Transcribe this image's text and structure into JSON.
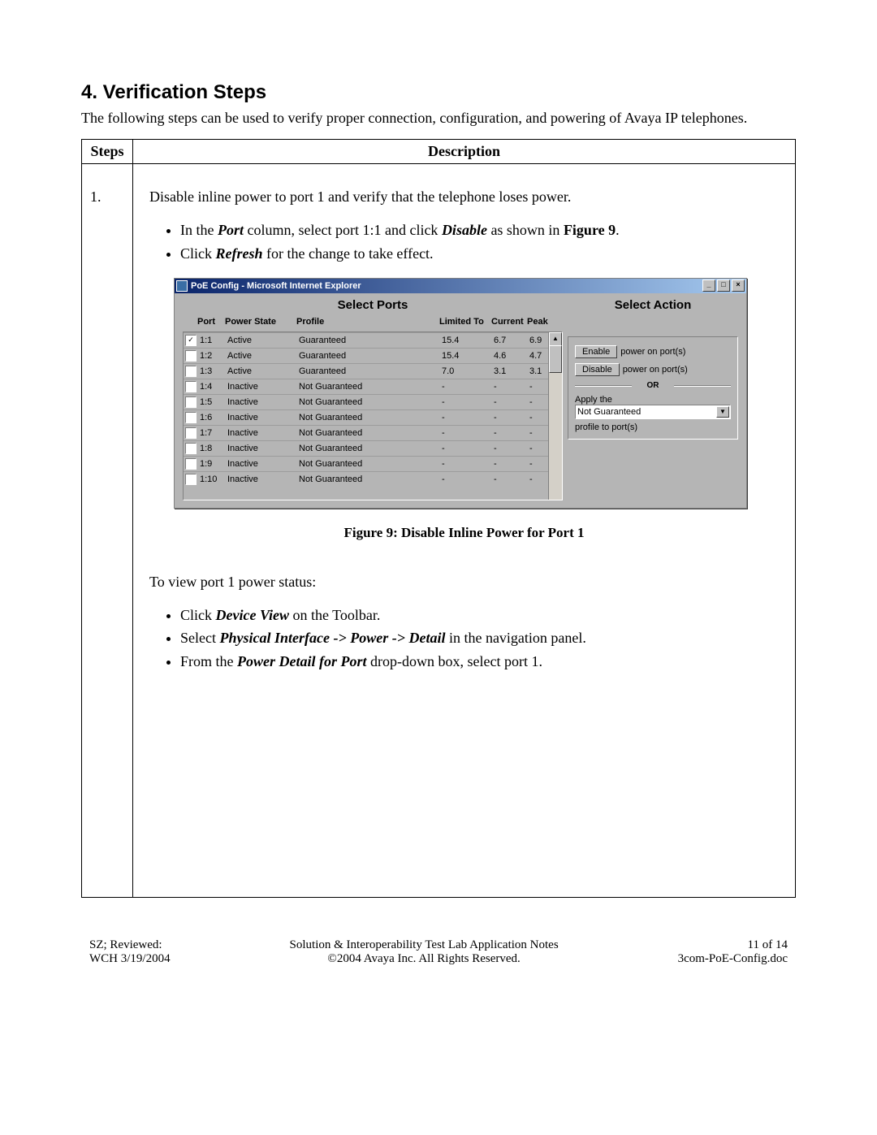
{
  "heading": "4.  Verification Steps",
  "intro": "The following steps can be used to verify proper connection, configuration, and powering of Avaya IP telephones.",
  "table_headers": {
    "steps": "Steps",
    "description": "Description"
  },
  "step_number": "1.",
  "step_intro": "Disable inline power to port 1 and verify that the telephone loses power.",
  "bullet1_pre": "In the ",
  "bullet1_port": "Port",
  "bullet1_mid": " column, select port 1:1 and click ",
  "bullet1_disable": "Disable",
  "bullet1_mid2": " as shown in ",
  "bullet1_fig": "Figure 9",
  "bullet1_end": ".",
  "bullet2_pre": "Click ",
  "bullet2_refresh": "Refresh",
  "bullet2_end": " for the change to take effect.",
  "figure_caption": "Figure 9: Disable Inline Power for Port 1",
  "after_fig_text": "To view port 1 power status:",
  "bullet3_pre": "Click ",
  "bullet3_dv": "Device View",
  "bullet3_end": " on the Toolbar.",
  "bullet4_pre": "Select ",
  "bullet4_path": "Physical Interface -> Power -> Detail",
  "bullet4_end": " in the navigation panel.",
  "bullet5_pre": "From the ",
  "bullet5_pdfp": "Power Detail for Port",
  "bullet5_end": " drop-down box, select port 1.",
  "ie": {
    "title": "PoE Config - Microsoft Internet Explorer",
    "select_ports": "Select Ports",
    "select_action": "Select Action",
    "headers": {
      "port": "Port",
      "state": "Power State",
      "profile": "Profile",
      "limited": "Limited To",
      "current": "Current",
      "peak": "Peak"
    },
    "rows": [
      {
        "checked": true,
        "port": "1:1",
        "state": "Active",
        "profile": "Guaranteed",
        "limited": "15.4",
        "current": "6.7",
        "peak": "6.9"
      },
      {
        "checked": false,
        "port": "1:2",
        "state": "Active",
        "profile": "Guaranteed",
        "limited": "15.4",
        "current": "4.6",
        "peak": "4.7"
      },
      {
        "checked": false,
        "port": "1:3",
        "state": "Active",
        "profile": "Guaranteed",
        "limited": "7.0",
        "current": "3.1",
        "peak": "3.1"
      },
      {
        "checked": false,
        "port": "1:4",
        "state": "Inactive",
        "profile": "Not Guaranteed",
        "limited": "-",
        "current": "-",
        "peak": "-"
      },
      {
        "checked": false,
        "port": "1:5",
        "state": "Inactive",
        "profile": "Not Guaranteed",
        "limited": "-",
        "current": "-",
        "peak": "-"
      },
      {
        "checked": false,
        "port": "1:6",
        "state": "Inactive",
        "profile": "Not Guaranteed",
        "limited": "-",
        "current": "-",
        "peak": "-"
      },
      {
        "checked": false,
        "port": "1:7",
        "state": "Inactive",
        "profile": "Not Guaranteed",
        "limited": "-",
        "current": "-",
        "peak": "-"
      },
      {
        "checked": false,
        "port": "1:8",
        "state": "Inactive",
        "profile": "Not Guaranteed",
        "limited": "-",
        "current": "-",
        "peak": "-"
      },
      {
        "checked": false,
        "port": "1:9",
        "state": "Inactive",
        "profile": "Not Guaranteed",
        "limited": "-",
        "current": "-",
        "peak": "-"
      },
      {
        "checked": false,
        "port": "1:10",
        "state": "Inactive",
        "profile": "Not Guaranteed",
        "limited": "-",
        "current": "-",
        "peak": "-"
      }
    ],
    "enable_btn": "Enable",
    "disable_btn": "Disable",
    "power_on_ports": "power on port(s)",
    "or": "OR",
    "apply_the": "Apply the",
    "profile_select": "Not Guaranteed",
    "profile_to_ports": "profile to port(s)"
  },
  "footer": {
    "left": "SZ; Reviewed:\nWCH 3/19/2004",
    "center": "Solution & Interoperability Test Lab Application Notes\n©2004 Avaya Inc. All Rights Reserved.",
    "right": "11 of 14\n3com-PoE-Config.doc"
  }
}
